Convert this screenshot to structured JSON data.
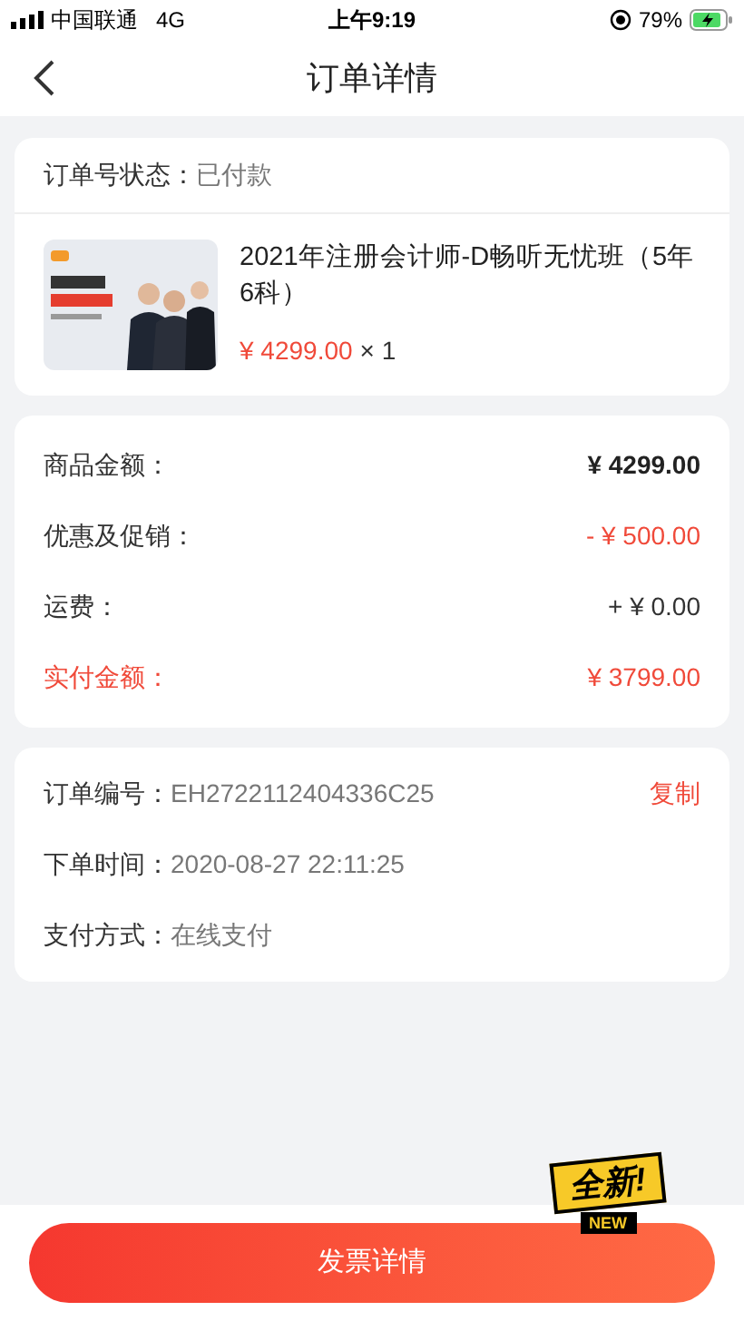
{
  "status_bar": {
    "carrier": "中国联通",
    "network": "4G",
    "time": "上午9:19",
    "battery_percent": "79%"
  },
  "nav": {
    "title": "订单详情"
  },
  "order_status": {
    "label": "订单号状态：",
    "value": "已付款"
  },
  "product": {
    "title": "2021年注册会计师-D畅听无忧班（5年6科）",
    "price": "¥ 4299.00",
    "quantity": "× 1"
  },
  "amounts": [
    {
      "label": "商品金额：",
      "value": "¥ 4299.00",
      "kind": "bold"
    },
    {
      "label": "优惠及促销：",
      "value": "- ¥ 500.00",
      "kind": "red"
    },
    {
      "label": "运费：",
      "value": "+ ¥ 0.00",
      "kind": "plain"
    },
    {
      "label": "实付金额：",
      "value": "¥ 3799.00",
      "kind": "total"
    }
  ],
  "info": [
    {
      "label": "订单编号：",
      "value": "EH2722112404336C25",
      "action": "复制"
    },
    {
      "label": "下单时间：",
      "value": "2020-08-27 22:11:25"
    },
    {
      "label": "支付方式：",
      "value": "在线支付"
    }
  ],
  "badge": {
    "text": "全新!",
    "subtext": "NEW"
  },
  "invoice_button": "发票详情"
}
